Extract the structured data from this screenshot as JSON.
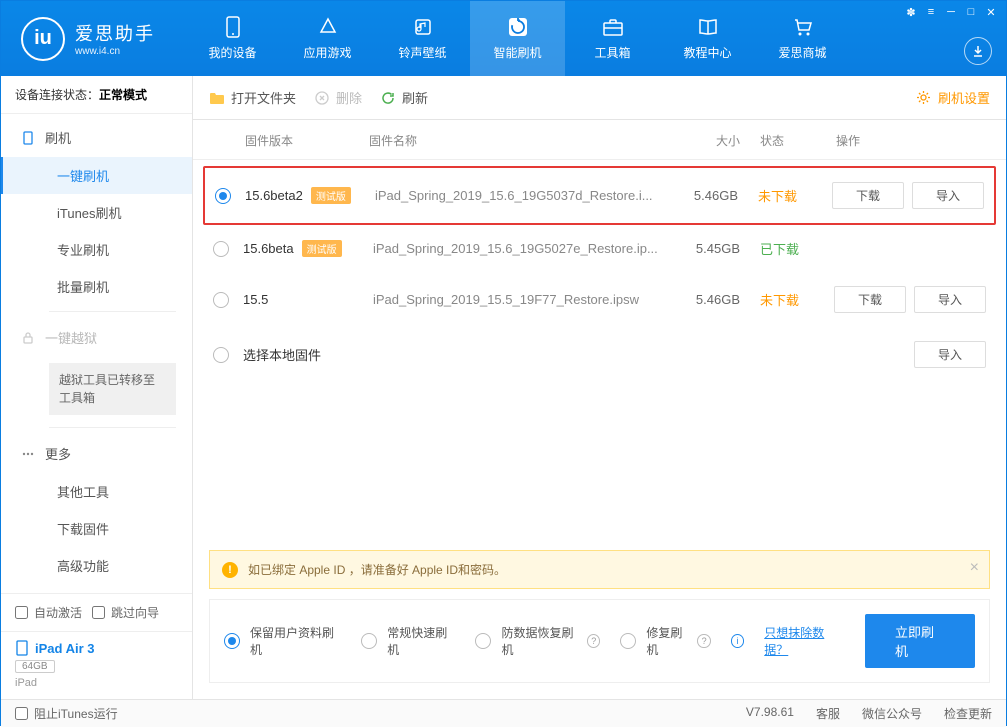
{
  "header": {
    "app_title": "爱思助手",
    "app_url": "www.i4.cn",
    "nav": [
      {
        "label": "我的设备"
      },
      {
        "label": "应用游戏"
      },
      {
        "label": "铃声壁纸"
      },
      {
        "label": "智能刷机"
      },
      {
        "label": "工具箱"
      },
      {
        "label": "教程中心"
      },
      {
        "label": "爱思商城"
      }
    ]
  },
  "sidebar": {
    "status_label": "设备连接状态：",
    "status_value": "正常模式",
    "groups": {
      "flash": "刷机",
      "jailbreak": "一键越狱",
      "more": "更多"
    },
    "items": {
      "one_key_flash": "一键刷机",
      "itunes_flash": "iTunes刷机",
      "pro_flash": "专业刷机",
      "batch_flash": "批量刷机",
      "jail_note": "越狱工具已转移至工具箱",
      "other_tools": "其他工具",
      "download_fw": "下载固件",
      "advanced": "高级功能"
    },
    "auto_activate": "自动激活",
    "skip_guide": "跳过向导",
    "device": {
      "name": "iPad Air 3",
      "storage": "64GB",
      "type": "iPad"
    }
  },
  "toolbar": {
    "open_folder": "打开文件夹",
    "delete": "删除",
    "refresh": "刷新",
    "settings": "刷机设置"
  },
  "table": {
    "headers": {
      "version": "固件版本",
      "name": "固件名称",
      "size": "大小",
      "status": "状态",
      "action": "操作"
    },
    "rows": [
      {
        "version": "15.6beta2",
        "beta": true,
        "name": "iPad_Spring_2019_15.6_19G5037d_Restore.i...",
        "size": "5.46GB",
        "status": "未下载",
        "status_class": "nd",
        "selected": true,
        "highlight": true,
        "show_actions": true
      },
      {
        "version": "15.6beta",
        "beta": true,
        "name": "iPad_Spring_2019_15.6_19G5027e_Restore.ip...",
        "size": "5.45GB",
        "status": "已下载",
        "status_class": "dd",
        "selected": false,
        "highlight": false,
        "show_actions": false
      },
      {
        "version": "15.5",
        "beta": false,
        "name": "iPad_Spring_2019_15.5_19F77_Restore.ipsw",
        "size": "5.46GB",
        "status": "未下载",
        "status_class": "nd",
        "selected": false,
        "highlight": false,
        "show_actions": true
      }
    ],
    "local_fw": "选择本地固件",
    "beta_tag": "测试版",
    "btn_download": "下载",
    "btn_import": "导入"
  },
  "notice": "如已绑定 Apple ID ，请准备好 Apple ID和密码。",
  "options": {
    "keep_data": "保留用户资料刷机",
    "normal": "常规快速刷机",
    "recovery": "防数据恢复刷机",
    "repair": "修复刷机",
    "erase_link": "只想抹除数据？",
    "flash_now": "立即刷机"
  },
  "footer": {
    "block_itunes": "阻止iTunes运行",
    "version": "V7.98.61",
    "service": "客服",
    "wechat": "微信公众号",
    "check_update": "检查更新"
  }
}
